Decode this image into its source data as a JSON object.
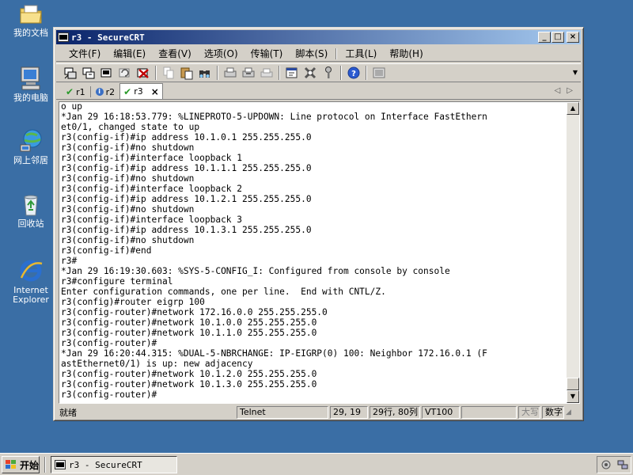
{
  "desktop": {
    "icons": [
      {
        "label": "我的文档",
        "icon": "folder-documents-icon"
      },
      {
        "label": "我的电脑",
        "icon": "computer-icon"
      },
      {
        "label": "网上邻居",
        "icon": "network-icon"
      },
      {
        "label": "回收站",
        "icon": "recycle-bin-icon"
      },
      {
        "label": "Internet Explorer",
        "icon": "internet-explorer-icon"
      }
    ]
  },
  "window": {
    "title": "r3 - SecureCRT",
    "buttons": {
      "minimize": "_",
      "maximize": "□",
      "close": "×"
    }
  },
  "menu": {
    "items": [
      "文件(F)",
      "编辑(E)",
      "查看(V)",
      "选项(O)",
      "传输(T)",
      "脚本(S)",
      "工具(L)",
      "帮助(H)"
    ]
  },
  "toolbar": {
    "icons": [
      "connect-icon",
      "quick-connect-icon",
      "connect-tab-icon",
      "reconnect-icon",
      "disconnect-icon",
      "copy-icon",
      "paste-icon",
      "find-icon",
      "print-setup-icon",
      "print-screen-icon",
      "print-icon",
      "session-options-icon",
      "global-options-icon",
      "key-icon",
      "help-icon",
      "keymap-icon"
    ]
  },
  "tabs": [
    {
      "label": "r1",
      "status": "connected",
      "active": false
    },
    {
      "label": "r2",
      "status": "info",
      "active": false
    },
    {
      "label": "r3",
      "status": "connected",
      "active": true
    }
  ],
  "tab_nav": {
    "prev": "◁",
    "next": "▷"
  },
  "terminal": {
    "lines": [
      "o up",
      "*Jan 29 16:18:53.779: %LINEPROTO-5-UPDOWN: Line protocol on Interface FastEthern",
      "et0/1, changed state to up",
      "r3(config-if)#ip address 10.1.0.1 255.255.255.0",
      "r3(config-if)#no shutdown",
      "r3(config-if)#interface loopback 1",
      "r3(config-if)#ip address 10.1.1.1 255.255.255.0",
      "r3(config-if)#no shutdown",
      "r3(config-if)#interface loopback 2",
      "r3(config-if)#ip address 10.1.2.1 255.255.255.0",
      "r3(config-if)#no shutdown",
      "r3(config-if)#interface loopback 3",
      "r3(config-if)#ip address 10.1.3.1 255.255.255.0",
      "r3(config-if)#no shutdown",
      "r3(config-if)#end",
      "r3#",
      "*Jan 29 16:19:30.603: %SYS-5-CONFIG_I: Configured from console by console",
      "r3#configure terminal",
      "Enter configuration commands, one per line.  End with CNTL/Z.",
      "r3(config)#router eigrp 100",
      "r3(config-router)#network 172.16.0.0 255.255.255.0",
      "r3(config-router)#network 10.1.0.0 255.255.255.0",
      "r3(config-router)#network 10.1.1.0 255.255.255.0",
      "r3(config-router)#",
      "*Jan 29 16:20:44.315: %DUAL-5-NBRCHANGE: IP-EIGRP(0) 100: Neighbor 172.16.0.1 (F",
      "astEthernet0/1) is up: new adjacency",
      "r3(config-router)#network 10.1.2.0 255.255.255.0",
      "r3(config-router)#network 10.1.3.0 255.255.255.0",
      "r3(config-router)#"
    ]
  },
  "statusbar": {
    "status": "就绪",
    "protocol": "Telnet",
    "cursor": "29, 19",
    "size": "29行, 80列",
    "terminal_type": "VT100",
    "caps": "大写",
    "num": "数字"
  },
  "taskbar": {
    "start_label": "开始",
    "task_label": "r3 - SecureCRT"
  }
}
